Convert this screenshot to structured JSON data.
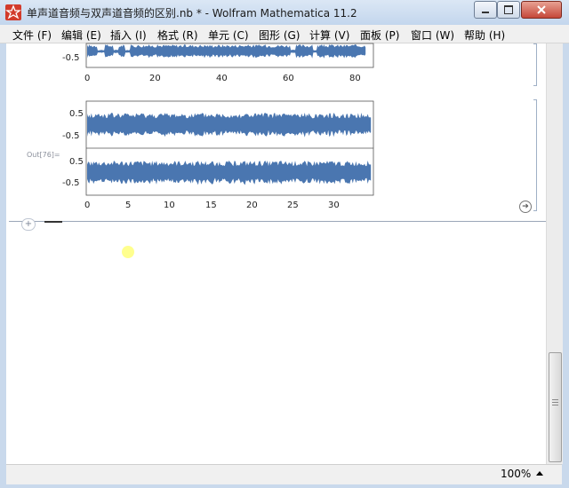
{
  "window": {
    "title": "单声道音频与双声道音频的区别.nb * - Wolfram Mathematica 11.2"
  },
  "menu": [
    {
      "label": "文件 (F)"
    },
    {
      "label": "编辑 (E)"
    },
    {
      "label": "插入 (I)"
    },
    {
      "label": "格式 (R)"
    },
    {
      "label": "单元 (C)"
    },
    {
      "label": "图形 (G)"
    },
    {
      "label": "计算 (V)"
    },
    {
      "label": "面板 (P)"
    },
    {
      "label": "窗口 (W)"
    },
    {
      "label": "帮助 (H)"
    }
  ],
  "notebook": {
    "out_label": "Out[76]=",
    "plus_label": "+"
  },
  "chart_data": [
    {
      "type": "area",
      "series": [
        {
          "values": []
        }
      ],
      "ytick_labels": [
        "-0.5"
      ],
      "xtick_labels": [
        "0",
        "20",
        "40",
        "60",
        "80"
      ],
      "xlim": [
        0,
        85
      ]
    },
    {
      "type": "area",
      "ytick_labels": [
        "0.5",
        "-0.5"
      ],
      "xtick_labels": [],
      "xlim": [
        0,
        34.5
      ],
      "ylim": [
        -0.75,
        0.75
      ]
    },
    {
      "type": "area",
      "ytick_labels": [
        "0.5",
        "-0.5"
      ],
      "xtick_labels": [
        "0",
        "5",
        "10",
        "15",
        "20",
        "25",
        "30"
      ],
      "xlim": [
        0,
        34.5
      ],
      "ylim": [
        -0.75,
        0.75
      ]
    }
  ],
  "status": {
    "zoom": "100%"
  },
  "colors": {
    "wave": "#4a76b0"
  }
}
